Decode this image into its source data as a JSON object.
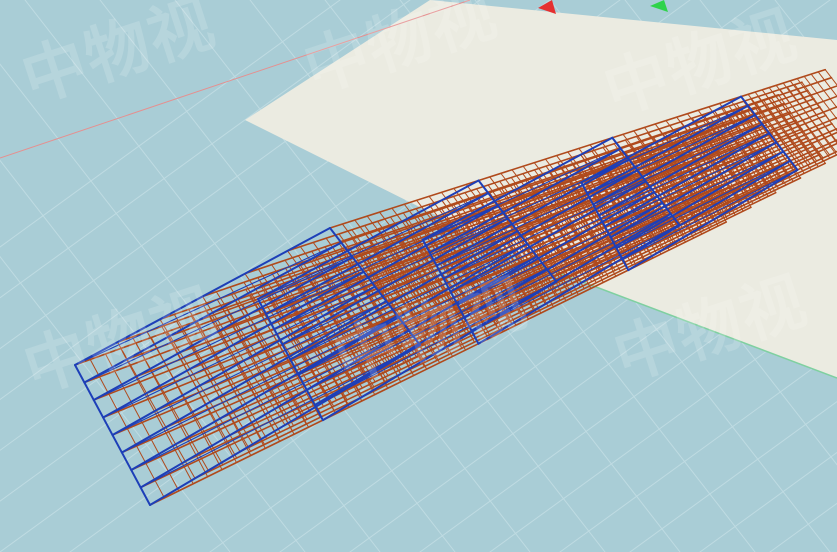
{
  "watermark": {
    "text": "中物视"
  },
  "gizmo": {
    "x_axis_color": "#e53030",
    "y_axis_color": "#2fd34a"
  },
  "colors": {
    "ground": "#a9cdd6",
    "grid_line": "#c7e0e6",
    "floor": "#ebebe1",
    "floor_edge": "#7fd0a0",
    "rack_beam": "#b04a1c",
    "rack_upright": "#1d3fb8",
    "x_axis_line": "#e59090"
  }
}
